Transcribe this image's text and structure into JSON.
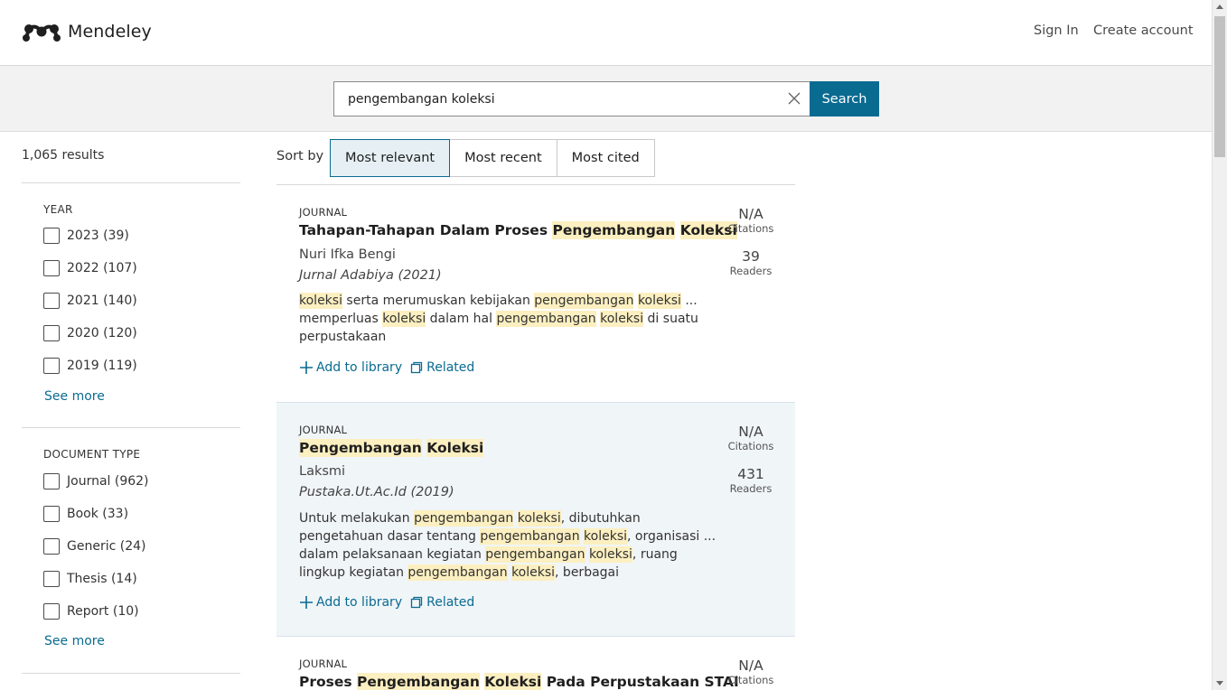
{
  "header": {
    "logo_text": "Mendeley",
    "sign_in": "Sign In",
    "create_account": "Create account"
  },
  "search": {
    "query": "pengembangan koleksi",
    "button_label": "Search"
  },
  "sidebar": {
    "results_count": "1,065 results",
    "year": {
      "title": "YEAR",
      "items": [
        "2023 (39)",
        "2022 (107)",
        "2021 (140)",
        "2020 (120)",
        "2019 (119)"
      ],
      "see_more": "See more"
    },
    "document_type": {
      "title": "DOCUMENT TYPE",
      "items": [
        "Journal (962)",
        "Book (33)",
        "Generic (24)",
        "Thesis (14)",
        "Report (10)"
      ],
      "see_more": "See more"
    }
  },
  "sort": {
    "label": "Sort by",
    "options": [
      "Most relevant",
      "Most recent",
      "Most cited"
    ],
    "selected": "Most relevant"
  },
  "results": [
    {
      "type": "JOURNAL",
      "title": "Tahapan-Tahapan Dalam Proses Pengembangan Koleksi",
      "author": "Nuri Ifka Bengi",
      "venue": "Jurnal Adabiya (2021)",
      "snippet": "koleksi serta merumuskan kebijakan pengembangan koleksi ... memperluas koleksi dalam hal pengembangan koleksi di suatu perpustakaan",
      "citations": "N/A",
      "citations_label": "Citations",
      "readers": "39",
      "readers_label": "Readers",
      "add_label": "Add to library",
      "related_label": "Related"
    },
    {
      "type": "JOURNAL",
      "title": "Pengembangan Koleksi",
      "author": "Laksmi",
      "venue": "Pustaka.Ut.Ac.Id (2019)",
      "snippet": "Untuk melakukan pengembangan koleksi, dibutuhkan pengetahuan dasar tentang pengembangan koleksi, organisasi ... dalam pelaksanaan kegiatan pengembangan koleksi, ruang lingkup kegiatan pengembangan koleksi, berbagai",
      "citations": "N/A",
      "citations_label": "Citations",
      "readers": "431",
      "readers_label": "Readers",
      "add_label": "Add to library",
      "related_label": "Related"
    },
    {
      "type": "JOURNAL",
      "title": "Proses Pengembangan Koleksi Pada Perpustakaan STAI",
      "citations": "N/A",
      "citations_label": "Citations"
    }
  ],
  "colors": {
    "accent": "#0a6b91",
    "highlight": "#fcefc0",
    "alt_card_bg": "#f0f5f8"
  },
  "icons": [
    "mendeley-logo-icon",
    "clear-icon",
    "plus-icon",
    "related-icon"
  ]
}
